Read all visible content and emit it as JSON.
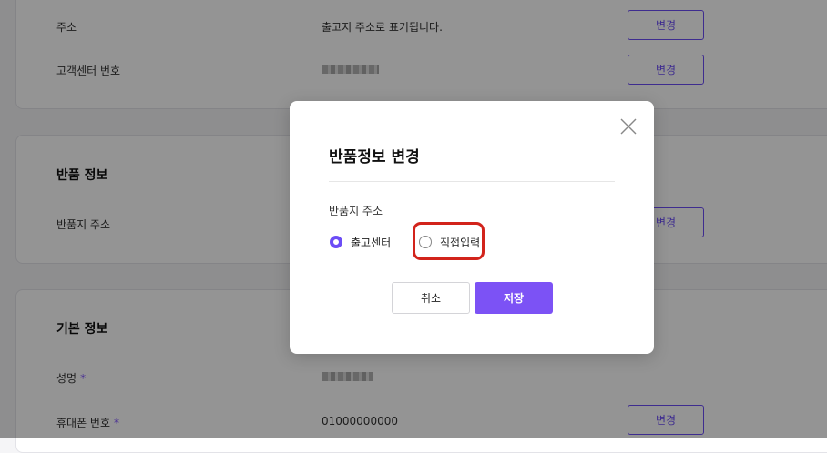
{
  "sections": {
    "address": {
      "label": "주소",
      "value": "출고지 주소로 표기됩니다.",
      "edit_label": "변경"
    },
    "cs_phone": {
      "label": "고객센터 번호",
      "edit_label": "변경"
    },
    "return_info": {
      "title": "반품 정보",
      "return_address_label": "반품지 주소",
      "edit_label": "변경"
    },
    "basic_info": {
      "title": "기본 정보",
      "name_label": "성명",
      "required_mark": "*",
      "phone_label": "휴대폰 번호",
      "phone_value": "01000000000",
      "edit_label": "변경"
    }
  },
  "modal": {
    "title": "반품정보 변경",
    "field_label": "반품지 주소",
    "options": [
      {
        "label": "출고센터",
        "selected": true
      },
      {
        "label": "직접입력",
        "selected": false
      }
    ],
    "cancel_label": "취소",
    "save_label": "저장",
    "close_icon": "close-icon"
  },
  "colors": {
    "accent": "#6c4df6",
    "highlight": "#d2231b"
  }
}
